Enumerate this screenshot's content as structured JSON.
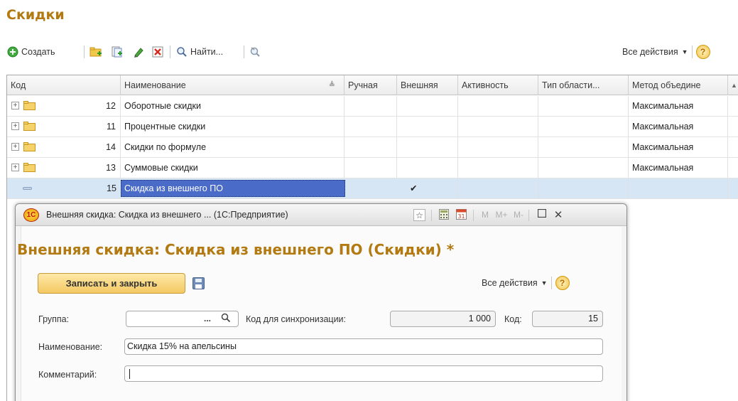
{
  "list": {
    "title": "Скидки",
    "toolbar": {
      "create_label": "Создать",
      "find_label": "Найти...",
      "all_actions_label": "Все действия"
    },
    "columns": [
      "Код",
      "Наименование",
      "Ручная",
      "Внешняя",
      "Активность",
      "Тип области...",
      "Метод объедине"
    ],
    "rows": [
      {
        "code": "12",
        "name": "Оборотные скидки",
        "method": "Максимальная",
        "external": ""
      },
      {
        "code": "11",
        "name": "Процентные скидки",
        "method": "Максимальная",
        "external": ""
      },
      {
        "code": "14",
        "name": "Скидки по формуле",
        "method": "Максимальная",
        "external": ""
      },
      {
        "code": "13",
        "name": "Суммовые скидки",
        "method": "Максимальная",
        "external": ""
      },
      {
        "code": "15",
        "name": "Скидка из внешнего ПО",
        "method": "",
        "external": "✔"
      }
    ]
  },
  "dialog": {
    "window_title": "Внешняя скидка: Скидка из внешнего ... (1С:Предприятие)",
    "logo_text": "1С",
    "heading": "Внешняя скидка: Скидка из внешнего ПО (Скидки) *",
    "save_close_label": "Записать и закрыть",
    "all_actions_label": "Все действия",
    "memory_buttons": [
      "M",
      "M+",
      "M-"
    ],
    "fields": {
      "group_label": "Группа:",
      "group_value": "",
      "sync_code_label": "Код для синхронизации:",
      "sync_code_value": "1 000",
      "code_label": "Код:",
      "code_value": "15",
      "name_label": "Наименование:",
      "name_value": "Скидка 15% на апельсины",
      "comment_label": "Комментарий:",
      "comment_value": ""
    }
  },
  "colors": {
    "accent_title": "#b27a10",
    "selection": "#4a6cc8",
    "row_selected": "#d7e6f5",
    "button_gold": "#f3c862"
  },
  "icons": [
    "plus-circle-icon",
    "add-folder-icon",
    "copy-icon",
    "edit-pencil-icon",
    "delete-icon",
    "search-icon",
    "clear-search-icon",
    "help-icon",
    "folder-icon",
    "expand-icon",
    "floppy-disk-icon",
    "favorite-icon",
    "calculator-icon",
    "calendar-icon",
    "maximize-icon",
    "close-icon"
  ]
}
